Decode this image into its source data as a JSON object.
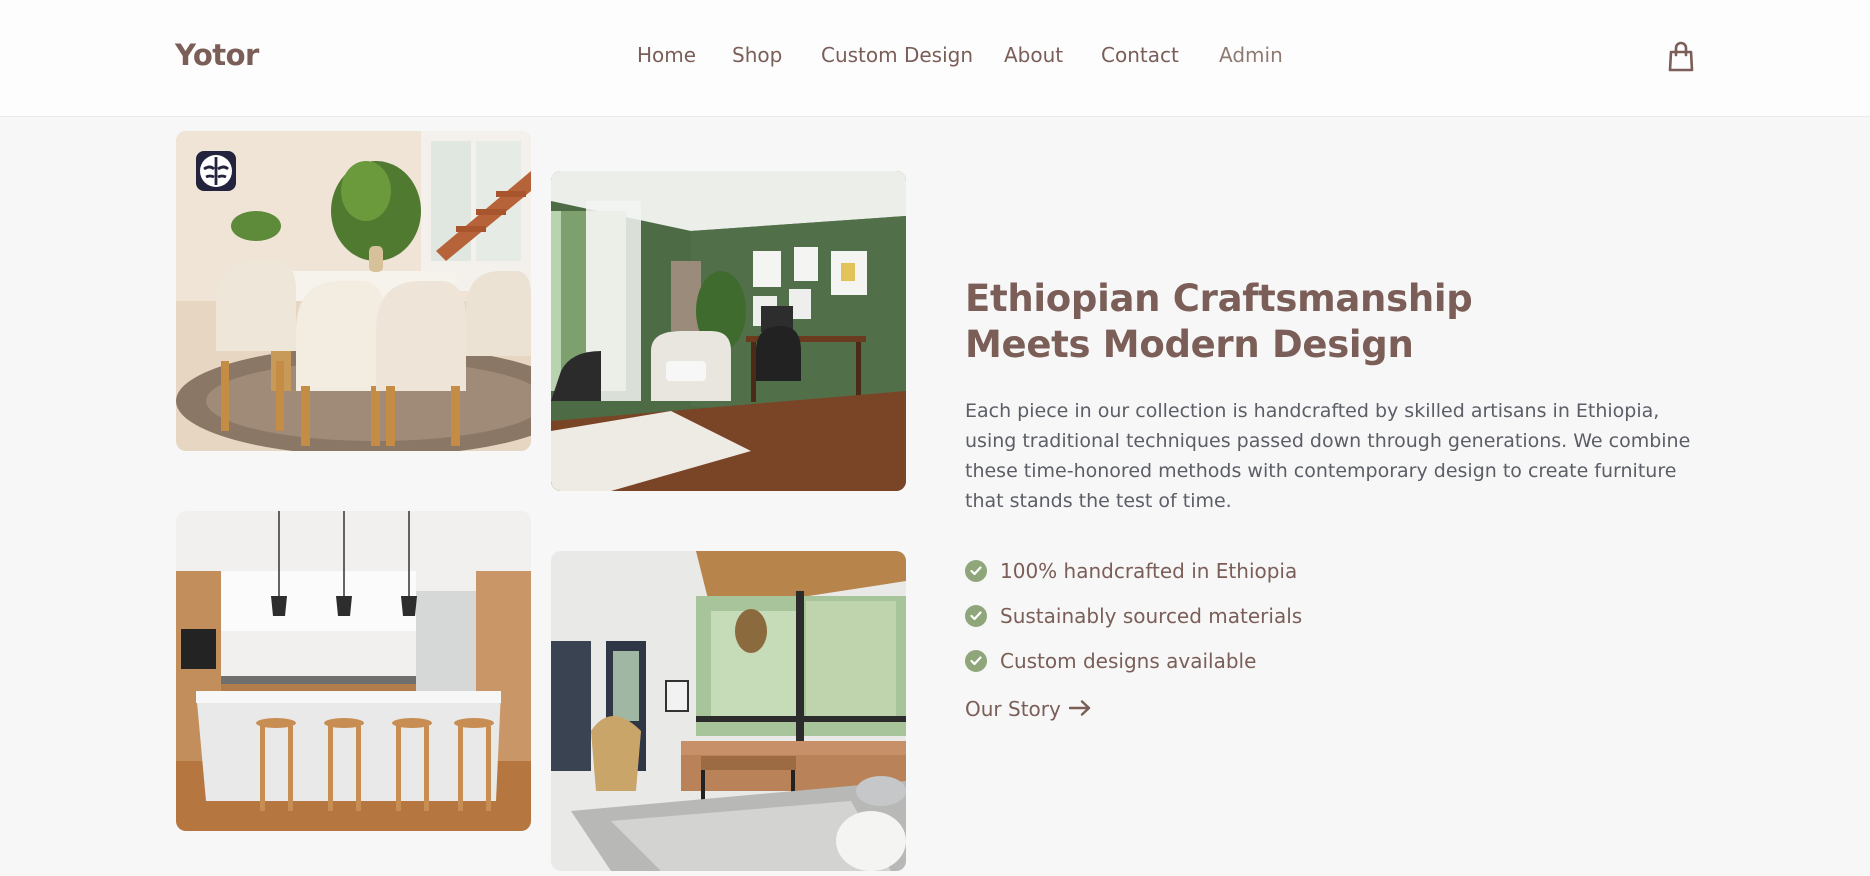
{
  "header": {
    "logo": "Yotor",
    "nav": [
      {
        "label": "Home"
      },
      {
        "label": "Shop"
      },
      {
        "label": "Custom Design"
      },
      {
        "label": "About"
      },
      {
        "label": "Contact"
      },
      {
        "label": "Admin"
      }
    ],
    "cart_icon": "shopping-bag-icon"
  },
  "gallery": {
    "images": [
      {
        "name": "dining-room-photo"
      },
      {
        "name": "green-office-photo"
      },
      {
        "name": "kitchen-island-photo"
      },
      {
        "name": "living-room-photo"
      }
    ],
    "badge_icon": "brain-icon"
  },
  "main": {
    "title_line1": "Ethiopian Craftsmanship",
    "title_line2": "Meets Modern Design",
    "description": "Each piece in our collection is handcrafted by skilled artisans in Ethiopia, using traditional techniques passed down through generations. We combine these time-honored methods with contemporary design to create furniture that stands the test of time.",
    "features": [
      "100% handcrafted in Ethiopia",
      "Sustainably sourced materials",
      "Custom designs available"
    ],
    "feature_icon": "check-circle-icon",
    "cta_label": "Our Story",
    "cta_icon": "arrow-right-icon"
  },
  "colors": {
    "brand": "#7a5e57",
    "check": "#8fa67b",
    "badge": "#23233d",
    "background": "#f7f7f7"
  }
}
